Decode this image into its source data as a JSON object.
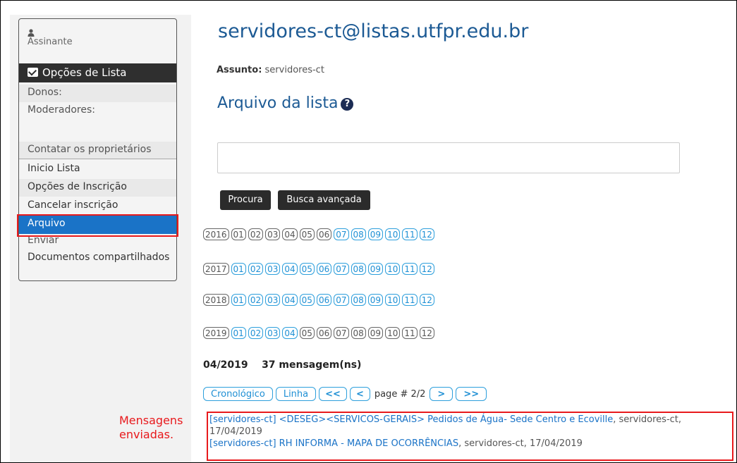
{
  "sidebar": {
    "user_label": "Assinante",
    "menu_title": "Opções de Lista",
    "owners_label": "Donos:",
    "moderators_label": "Moderadores:",
    "contact_label": "Contatar os proprietários",
    "items": [
      {
        "label": "Inicio Lista"
      },
      {
        "label": "Opções de Inscrição"
      },
      {
        "label": "Cancelar inscrição"
      },
      {
        "label": "Arquivo"
      },
      {
        "label": "Enviar"
      },
      {
        "label": "Documentos compartilhados"
      }
    ]
  },
  "header": {
    "title": "servidores-ct@listas.utfpr.edu.br",
    "subject_label": "Assunto:",
    "subject_value": "servidores-ct"
  },
  "archive": {
    "title": "Arquivo da lista",
    "search_value": "",
    "search_button": "Procura",
    "advanced_button": "Busca avançada",
    "years": [
      {
        "year": "2016",
        "months": [
          "01",
          "02",
          "03",
          "04",
          "05",
          "06",
          "07",
          "08",
          "09",
          "10",
          "11",
          "12"
        ],
        "active": [
          false,
          false,
          false,
          false,
          false,
          false,
          true,
          true,
          true,
          true,
          true,
          true
        ]
      },
      {
        "year": "2017",
        "months": [
          "01",
          "02",
          "03",
          "04",
          "05",
          "06",
          "07",
          "08",
          "09",
          "10",
          "11",
          "12"
        ],
        "active": [
          true,
          true,
          true,
          true,
          true,
          true,
          true,
          true,
          true,
          true,
          true,
          true
        ]
      },
      {
        "year": "2018",
        "months": [
          "01",
          "02",
          "03",
          "04",
          "05",
          "06",
          "07",
          "08",
          "09",
          "10",
          "11",
          "12"
        ],
        "active": [
          true,
          true,
          true,
          true,
          true,
          true,
          true,
          true,
          true,
          true,
          true,
          true
        ]
      },
      {
        "year": "2019",
        "months": [
          "01",
          "02",
          "03",
          "04",
          "05",
          "06",
          "07",
          "08",
          "09",
          "10",
          "11",
          "12"
        ],
        "active": [
          true,
          true,
          true,
          true,
          false,
          false,
          false,
          false,
          false,
          false,
          false,
          false
        ]
      }
    ],
    "current_month": "04/2019",
    "message_count": "37 mensagem(ns)",
    "pager": {
      "chrono": "Cronológico",
      "thread": "Linha",
      "first": "<<",
      "prev": "<",
      "page_text": "page # 2/2",
      "next": ">",
      "last": ">>"
    }
  },
  "annotation": {
    "line1": "Mensagens",
    "line2": "enviadas."
  },
  "messages": [
    {
      "subject": "[servidores-ct] <DESEG><SERVICOS-GERAIS> Pedidos de Água- Sede Centro e Ecoville",
      "meta": ", servidores-ct, 17/04/2019"
    },
    {
      "subject": "[servidores-ct] RH INFORMA - MAPA DE OCORRÊNCIAS",
      "meta": ", servidores-ct, 17/04/2019"
    }
  ],
  "colors": {
    "accent": "#1c5a94",
    "active_item": "#1a73c7",
    "highlight_box": "#e8191c",
    "month_link": "#1e8fd4"
  }
}
